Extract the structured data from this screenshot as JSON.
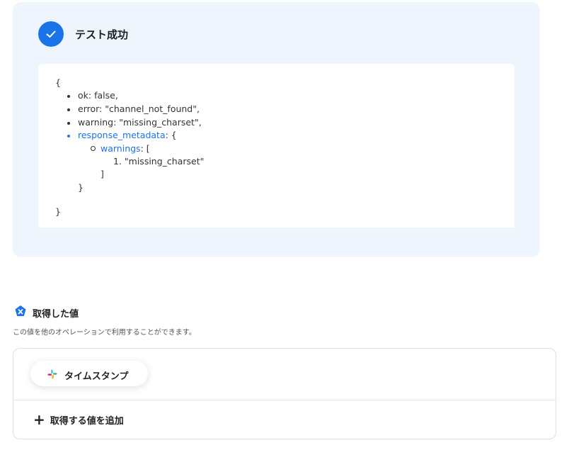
{
  "test_result": {
    "title": "テスト成功",
    "icon": "check-icon",
    "accent": "#1a73e8"
  },
  "response": {
    "open_brace": "{",
    "lines": [
      {
        "key": "ok",
        "value": "false,"
      },
      {
        "key": "error",
        "value": "\"channel_not_found\","
      },
      {
        "key": "warning",
        "value": "\"missing_charset\","
      }
    ],
    "metadata_key": "response_metadata",
    "metadata_open": ": {",
    "warnings_key": "warnings",
    "warnings_open": ": [",
    "warnings_items": [
      "\"missing_charset\""
    ],
    "warnings_close": "]",
    "metadata_close": "}",
    "close_brace": "}"
  },
  "acquired": {
    "title": "取得した値",
    "description": "この値を他のオペレーションで利用することができます。",
    "chips": [
      {
        "label": "タイムスタンプ",
        "icon": "slack-icon"
      }
    ],
    "add_label": "取得する値を追加"
  }
}
